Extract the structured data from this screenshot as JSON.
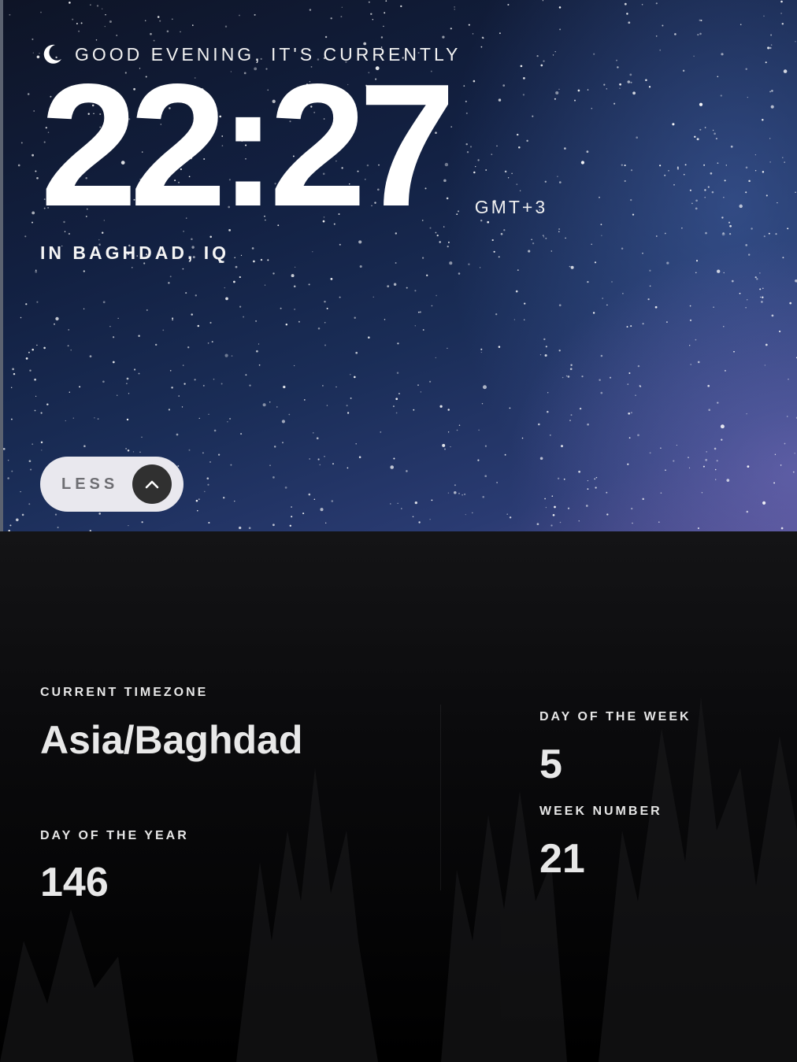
{
  "greeting": {
    "icon": "moon-icon",
    "text": "GOOD EVENING, IT'S CURRENTLY"
  },
  "clock": {
    "time": "22:27",
    "abbreviation": "GMT+3",
    "location": "IN BAGHDAD, IQ"
  },
  "toggle": {
    "label": "LESS",
    "icon": "chevron-up-icon"
  },
  "details": {
    "current_timezone": {
      "label": "CURRENT TIMEZONE",
      "value": "Asia/Baghdad"
    },
    "day_of_year": {
      "label": "DAY OF THE YEAR",
      "value": "146"
    },
    "day_of_week": {
      "label": "DAY OF THE WEEK",
      "value": "5"
    },
    "week_number": {
      "label": "WEEK NUMBER",
      "value": "21"
    }
  },
  "colors": {
    "sky_dark": "#0e1426",
    "sky_light": "#2a3b72",
    "toggle_bg": "#e9e8ee",
    "toggle_icon_bg": "#303030",
    "panel_bg": "#0a0a0c"
  }
}
